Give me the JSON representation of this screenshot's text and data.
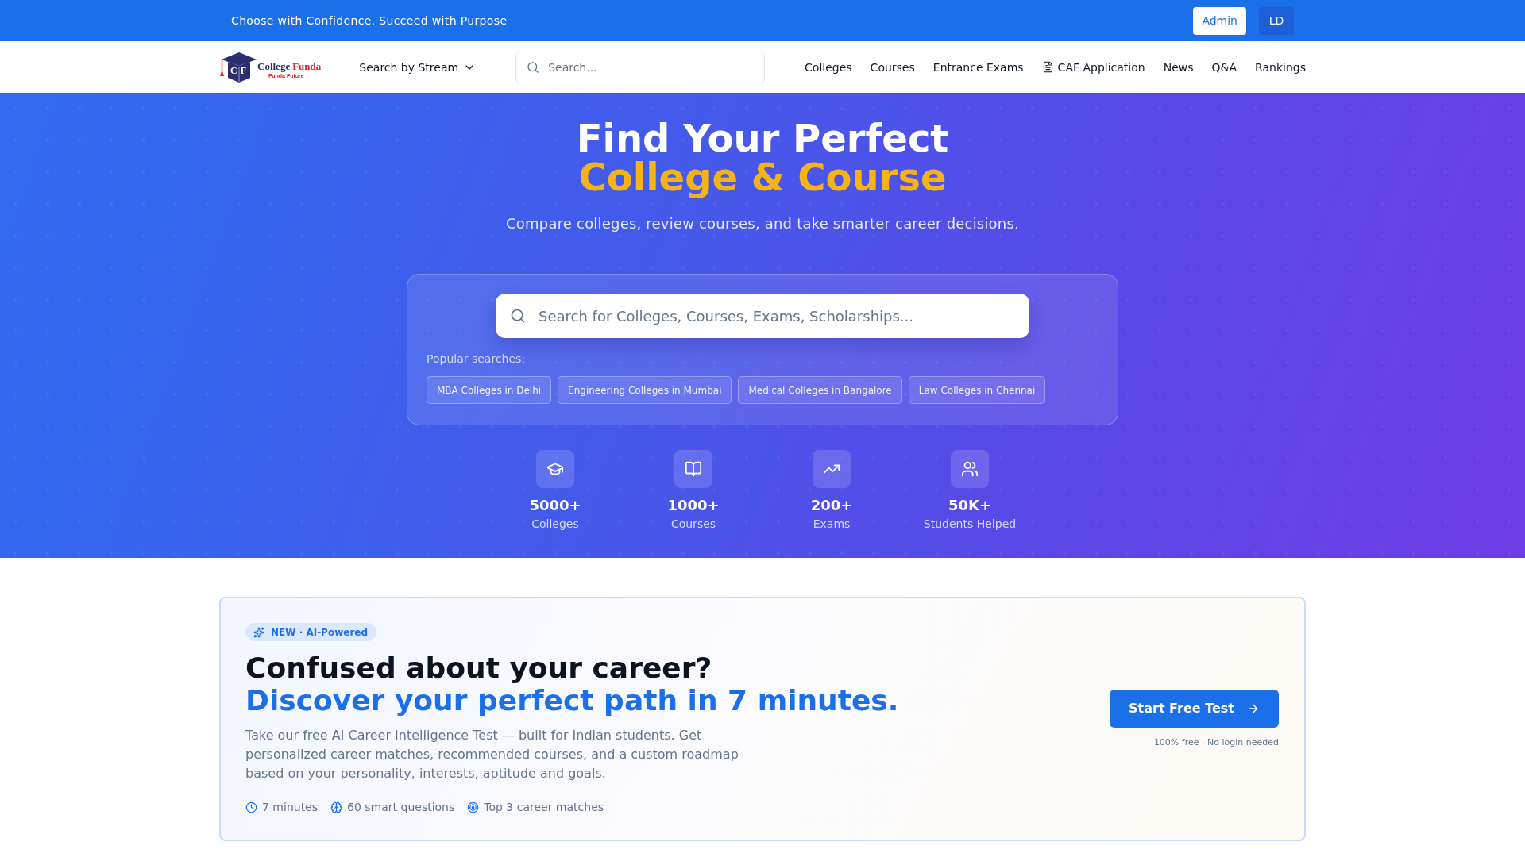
{
  "top_bar": {
    "tagline": "Choose with Confidence. Succeed with Purpose",
    "admin_button": "Admin",
    "user_initials": "LD"
  },
  "nav": {
    "logo": {
      "monogram": "CF",
      "name_primary": "College",
      "name_accent": "Funda",
      "tagline": "Funda Future"
    },
    "stream_menu": "Search by Stream",
    "search": {
      "placeholder": "Search..."
    },
    "links": [
      {
        "label": "Colleges",
        "kind": "plain"
      },
      {
        "label": "Courses",
        "kind": "plain"
      },
      {
        "label": "Entrance Exams",
        "kind": "plain"
      },
      {
        "label": "CAF Application",
        "kind": "document"
      },
      {
        "label": "News",
        "kind": "plain"
      },
      {
        "label": "Q&A",
        "kind": "plain"
      },
      {
        "label": "Rankings",
        "kind": "plain"
      }
    ]
  },
  "hero": {
    "title": "Find Your Perfect",
    "title_accent": "College & Course",
    "subtitle": "Compare colleges, review courses, and take smarter career decisions.",
    "search": {
      "placeholder": "Search for Colleges, Courses, Exams, Scholarships..."
    },
    "popular_label": "Popular searches:",
    "popular_searches": [
      "MBA Colleges in Delhi",
      "Engineering Colleges in Mumbai",
      "Medical Colleges in Bangalore",
      "Law Colleges in Chennai"
    ],
    "stats": [
      {
        "value": "5000+",
        "label": "Colleges"
      },
      {
        "value": "1000+",
        "label": "Courses"
      },
      {
        "value": "200+",
        "label": "Exams"
      },
      {
        "value": "50K+",
        "label": "Students Helped"
      }
    ]
  },
  "career_card": {
    "badge": "NEW · AI-Powered",
    "headline": "Confused about your career?",
    "headline_accent": "Discover your perfect path in 7 minutes.",
    "description": "Take our free AI Career Intelligence Test — built for Indian students. Get personalized career matches, recommended courses, and a custom roadmap based on your personality, interests, aptitude and goals.",
    "features": [
      "7 minutes",
      "60 smart questions",
      "Top 3 career matches"
    ],
    "cta": "Start Free Test",
    "cta_note": "100% free · No login needed"
  }
}
